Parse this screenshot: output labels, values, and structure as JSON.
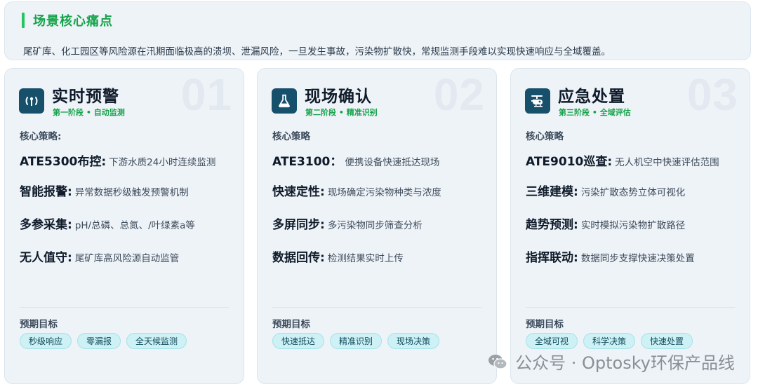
{
  "pain_point": {
    "title": "场景核心痛点",
    "description": "尾矿库、化工园区等风险源在汛期面临极高的溃坝、泄漏风险，一旦发生事故，污染物扩散快，常规监测手段难以实现快速响应与全域覆盖。"
  },
  "cards": [
    {
      "number": "01",
      "icon": "antenna-signal-icon",
      "title": "实时预警",
      "stage": "第一阶段 • 自动监测",
      "strategy_label": "核心策略:",
      "items": [
        {
          "key": "ATE5300布控:",
          "value": "下游水质24小时连续监测"
        },
        {
          "key": "智能报警:",
          "value": "异常数据秒级触发预警机制"
        },
        {
          "key": "多参采集:",
          "value": "pH/总磷、总氮、/叶绿素a等"
        },
        {
          "key": "无人值守:",
          "value": "尾矿库高风险源自动监管"
        }
      ],
      "goal_label": "预期目标",
      "tags": [
        "秒级响应",
        "零漏报",
        "全天候监测"
      ]
    },
    {
      "number": "02",
      "icon": "flask-icon",
      "title": "现场确认",
      "stage": "第二阶段 • 精准识别",
      "strategy_label": "核心策略",
      "items": [
        {
          "key": "ATE3100：",
          "value": "便携设备快速抵达现场"
        },
        {
          "key": "快速定性:",
          "value": "现场确定污染物种类与浓度"
        },
        {
          "key": "多屏同步:",
          "value": "多污染物同步筛查分析"
        },
        {
          "key": "数据回传:",
          "value": "检测结果实时上传"
        }
      ],
      "goal_label": "预期目标",
      "tags": [
        "快速抵达",
        "精准识别",
        "现场决策"
      ]
    },
    {
      "number": "03",
      "icon": "helicopter-icon",
      "title": "应急处置",
      "stage": "第三阶段 • 全域评估",
      "strategy_label": "核心策略",
      "items": [
        {
          "key": "ATE9010巡查:",
          "value": "无人机空中快速评估范围"
        },
        {
          "key": "三维建模:",
          "value": "污染扩散态势立体可视化"
        },
        {
          "key": "趋势预测:",
          "value": "实时模拟污染物扩散路径"
        },
        {
          "key": "指挥联动:",
          "value": "数据同步支撑快速决策处置"
        }
      ],
      "goal_label": "预期目标",
      "tags": [
        "全域可视",
        "科学决策",
        "快速处置"
      ]
    }
  ],
  "watermark": "公众号 · Optosky环保产品线",
  "colors": {
    "accent_green": "#16a34a",
    "icon_bg": "#16506b",
    "tag_bg": "#cdf1f5",
    "card_bg": "#eef3f8"
  }
}
